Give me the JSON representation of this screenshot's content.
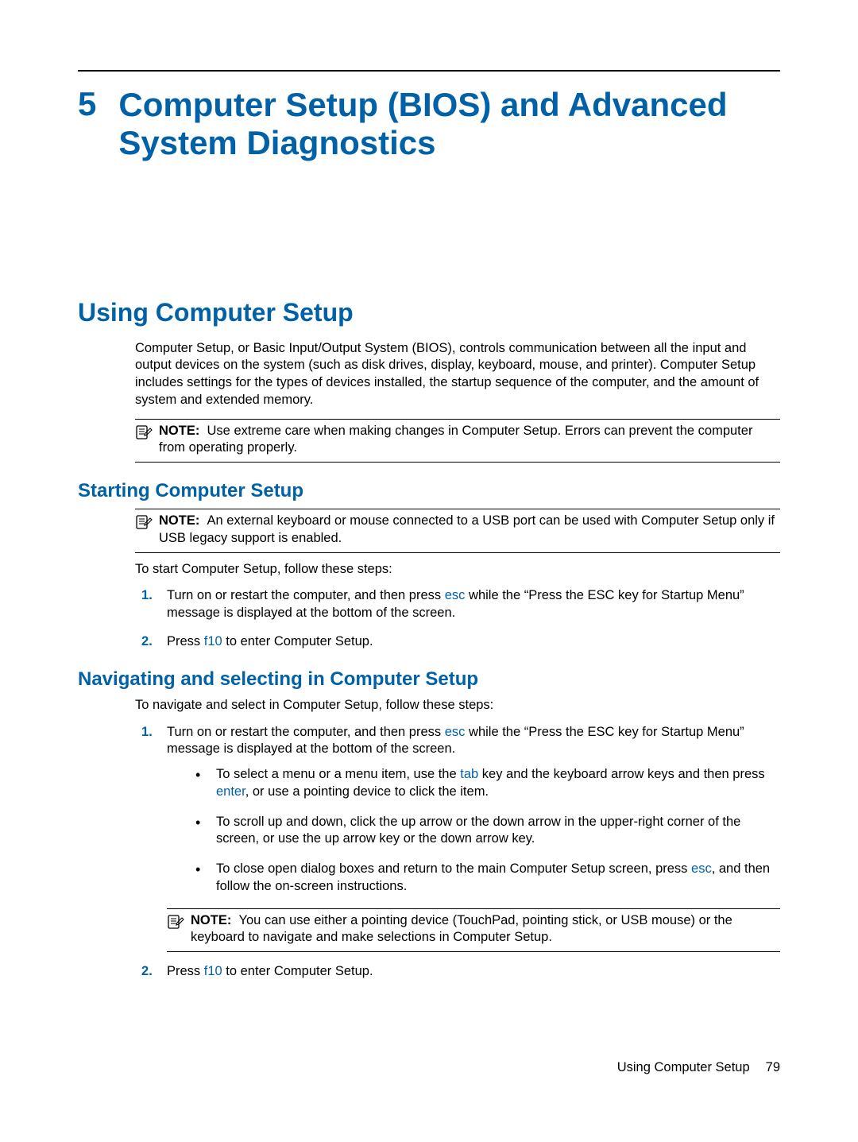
{
  "chapter": {
    "number": "5",
    "title": "Computer Setup (BIOS) and Advanced System Diagnostics"
  },
  "h1": "Using Computer Setup",
  "intro": "Computer Setup, or Basic Input/Output System (BIOS), controls communication between all the input and output devices on the system (such as disk drives, display, keyboard, mouse, and printer). Computer Setup includes settings for the types of devices installed, the startup sequence of the computer, and the amount of system and extended memory.",
  "note1": {
    "label": "NOTE:",
    "text": "Use extreme care when making changes in Computer Setup. Errors can prevent the computer from operating properly."
  },
  "starting": {
    "heading": "Starting Computer Setup",
    "note": {
      "label": "NOTE:",
      "text": "An external keyboard or mouse connected to a USB port can be used with Computer Setup only if USB legacy support is enabled."
    },
    "lead": "To start Computer Setup, follow these steps:",
    "step1_a": "Turn on or restart the computer, and then press ",
    "step1_key": "esc",
    "step1_b": " while the “Press the ESC key for Startup Menu” message is displayed at the bottom of the screen.",
    "step2_a": "Press ",
    "step2_key": "f10",
    "step2_b": " to enter Computer Setup."
  },
  "navigating": {
    "heading": "Navigating and selecting in Computer Setup",
    "lead": "To navigate and select in Computer Setup, follow these steps:",
    "step1_a": "Turn on or restart the computer, and then press ",
    "step1_key": "esc",
    "step1_b": " while the “Press the ESC key for Startup Menu” message is displayed at the bottom of the screen.",
    "b1_a": "To select a menu or a menu item, use the ",
    "b1_key1": "tab",
    "b1_b": " key and the keyboard arrow keys and then press ",
    "b1_key2": "enter",
    "b1_c": ", or use a pointing device to click the item.",
    "b2": "To scroll up and down, click the up arrow or the down arrow in the upper-right corner of the screen, or use the up arrow key or the down arrow key.",
    "b3_a": "To close open dialog boxes and return to the main Computer Setup screen, press ",
    "b3_key": "esc",
    "b3_b": ", and then follow the on-screen instructions.",
    "note": {
      "label": "NOTE:",
      "text": "You can use either a pointing device (TouchPad, pointing stick, or USB mouse) or the keyboard to navigate and make selections in Computer Setup."
    },
    "step2_a": "Press ",
    "step2_key": "f10",
    "step2_b": " to enter Computer Setup."
  },
  "footer": {
    "section": "Using Computer Setup",
    "page": "79"
  }
}
